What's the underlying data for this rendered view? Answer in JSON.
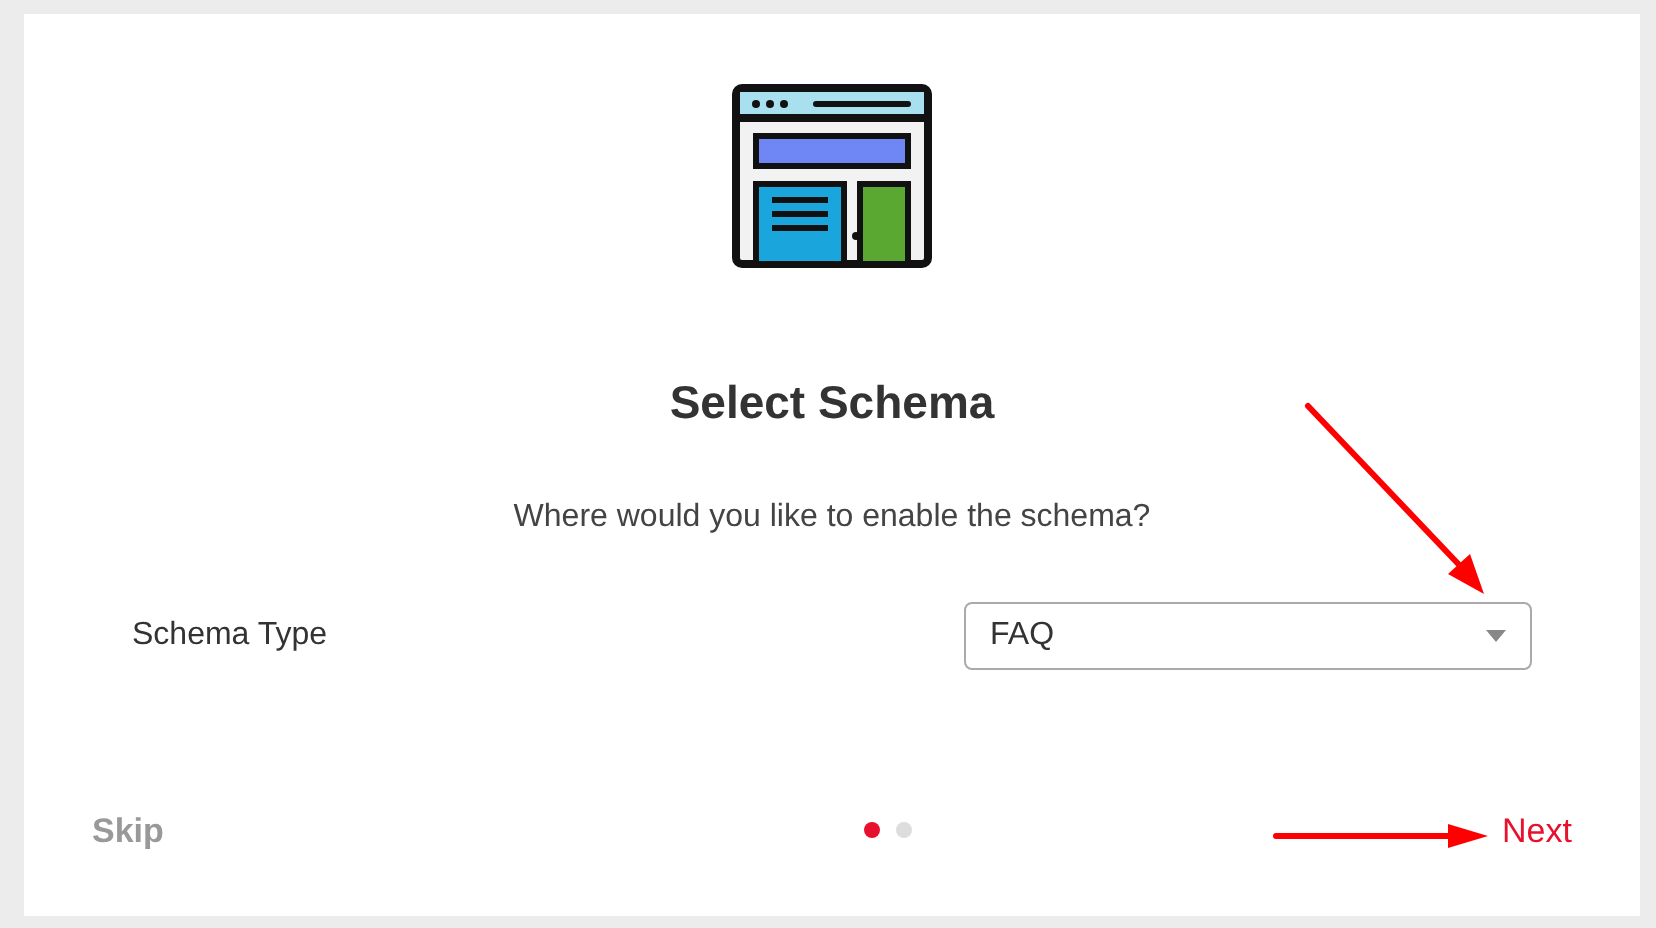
{
  "title": "Select Schema",
  "subtitle": "Where would you like to enable the schema?",
  "field": {
    "label": "Schema Type",
    "value": "FAQ"
  },
  "steps": [
    {
      "selected": true
    },
    {
      "selected": false
    }
  ],
  "skip": "Skip",
  "next": "Next"
}
